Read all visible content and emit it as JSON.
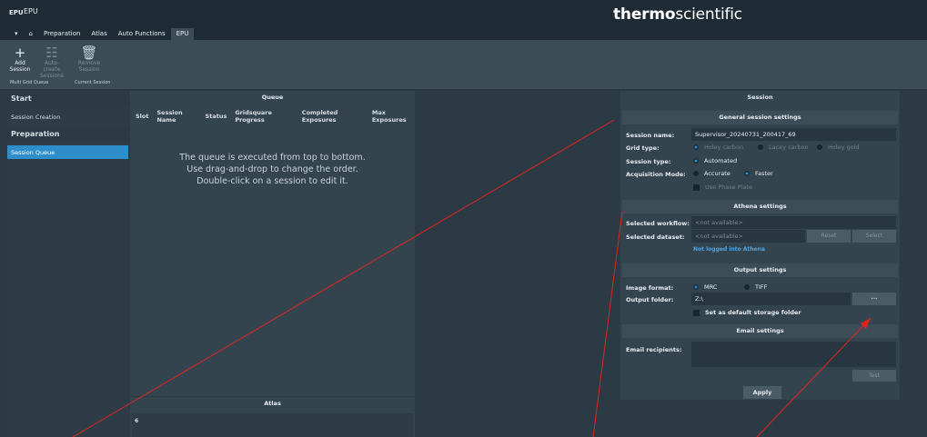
{
  "app": {
    "logo": "EPU",
    "title": "EPU",
    "brand_bold": "thermo",
    "brand_light": "scientific"
  },
  "tabs": [
    "Preparation",
    "Atlas",
    "Auto Functions",
    "EPU"
  ],
  "ribbon": {
    "add_session": [
      "Add",
      "Session"
    ],
    "auto_create": [
      "Auto-create",
      "Sessions"
    ],
    "remove_session": [
      "Remove",
      "Session"
    ],
    "group_multi": "Multi Grid Queue",
    "group_current": "Current Session"
  },
  "nav": {
    "start": "Start",
    "session_creation": "Session Creation",
    "preparation": "Preparation",
    "session_queue": "Session Queue"
  },
  "queue": {
    "title": "Queue",
    "columns": [
      "Slot",
      "Session Name",
      "Status",
      "Gridsquare Progress",
      "Completed Exposures",
      "Max Exposures"
    ],
    "message": [
      "The queue is executed from top to bottom.",
      "Use drag-and-drop to change the order.",
      "Double-click on a session to edit it."
    ]
  },
  "atlas": {
    "title": "Atlas",
    "value": "6"
  },
  "session": {
    "title": "Session",
    "general": {
      "title": "General session settings",
      "name_label": "Session name:",
      "name_value": "Supervisor_20240731_200417_69",
      "grid_label": "Grid type:",
      "grid_options": [
        "Holey carbon",
        "Lacey carbon",
        "Holey gold"
      ],
      "type_label": "Session type:",
      "type_value": "Automated",
      "mode_label": "Acquisition Mode:",
      "mode_accurate": "Accurate",
      "mode_faster": "Faster",
      "phase_plate": "Use Phase Plate"
    },
    "athena": {
      "title": "Athena settings",
      "workflow_label": "Selected workflow:",
      "workflow_value": "<not available>",
      "dataset_label": "Selected dataset:",
      "dataset_value": "<not available>",
      "reset": "Reset",
      "select": "Select",
      "login_link": "Not logged into Athena"
    },
    "output": {
      "title": "Output settings",
      "format_label": "Image format:",
      "format_mrc": "MRC",
      "format_tiff": "TIFF",
      "folder_label": "Output folder:",
      "folder_value": "Z:\\",
      "browse": "...",
      "default_storage": "Set as default storage folder"
    },
    "email": {
      "title": "Email settings",
      "recipients_label": "Email recipients:",
      "test": "Test"
    },
    "apply": "Apply"
  },
  "colors": {
    "accent": "#2e8ecb",
    "annotation_line": "#e0241b",
    "link": "#4aa6e8"
  }
}
